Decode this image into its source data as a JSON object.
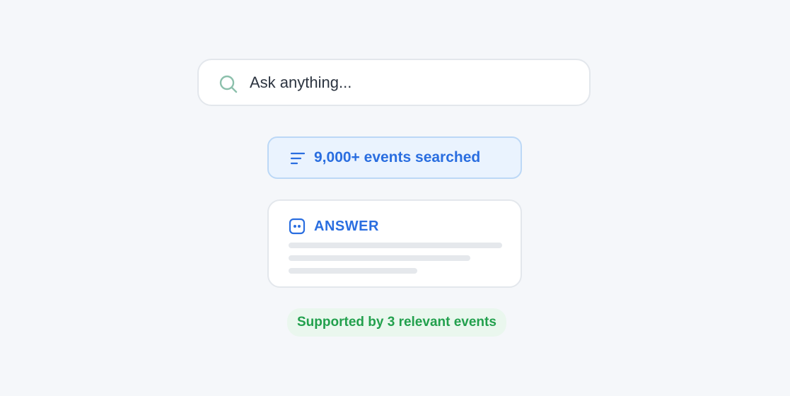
{
  "search": {
    "placeholder": "Ask anything...",
    "icon": "search-icon"
  },
  "events_summary": {
    "label": "9,000+ events searched",
    "icon": "filter-lines-icon"
  },
  "answer_card": {
    "heading": "ANSWER",
    "icon": "bot-face-icon"
  },
  "support": {
    "label": "Supported by 3 relevant events"
  },
  "colors": {
    "background": "#f5f7fa",
    "accent_blue": "#2a6ee0",
    "accent_green": "#22a04d",
    "search_icon": "#8cc0ac"
  }
}
